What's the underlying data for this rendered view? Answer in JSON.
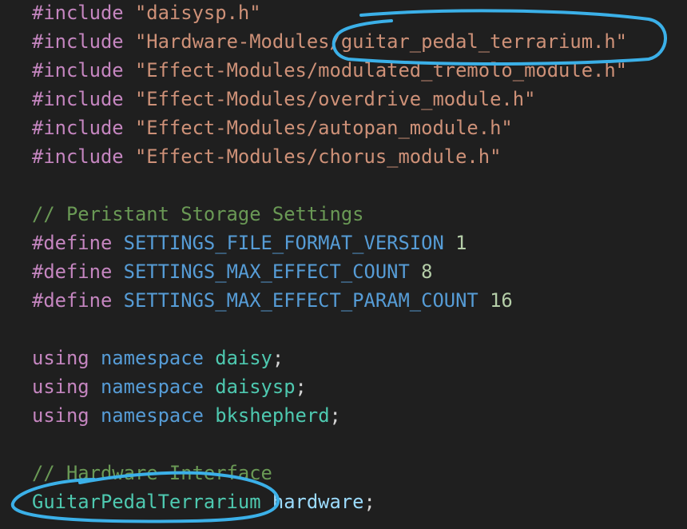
{
  "colors": {
    "background": "#1f1f1f",
    "preprocessor": "#c586c0",
    "string": "#ce9178",
    "macro": "#569cd6",
    "number": "#b5cea8",
    "comment": "#6a9955",
    "keyword": "#c586c0",
    "namespace_kw": "#569cd6",
    "namespace_name": "#4ec9b0",
    "type": "#4ec9b0",
    "identifier": "#9cdcfe",
    "punctuation": "#d4d4d4",
    "annotation": "#3bb0e8"
  },
  "annotations": [
    {
      "shape": "ellipse",
      "encircles": "guitar_pedal_terrarium.h"
    },
    {
      "shape": "ellipse",
      "encircles": "GuitarPedalTerrarium"
    }
  ],
  "lines": [
    {
      "tokens": [
        {
          "t": "#include",
          "c": "preprocessor"
        },
        {
          "t": " ",
          "c": "punctuation"
        },
        {
          "t": "\"daisysp.h\"",
          "c": "string"
        }
      ]
    },
    {
      "tokens": [
        {
          "t": "#include",
          "c": "preprocessor"
        },
        {
          "t": " ",
          "c": "punctuation"
        },
        {
          "t": "\"Hardware-Modules/guitar_pedal_terrarium.h\"",
          "c": "string"
        }
      ]
    },
    {
      "tokens": [
        {
          "t": "#include",
          "c": "preprocessor"
        },
        {
          "t": " ",
          "c": "punctuation"
        },
        {
          "t": "\"Effect-Modules/modulated_tremolo_module.h\"",
          "c": "string"
        }
      ]
    },
    {
      "tokens": [
        {
          "t": "#include",
          "c": "preprocessor"
        },
        {
          "t": " ",
          "c": "punctuation"
        },
        {
          "t": "\"Effect-Modules/overdrive_module.h\"",
          "c": "string"
        }
      ]
    },
    {
      "tokens": [
        {
          "t": "#include",
          "c": "preprocessor"
        },
        {
          "t": " ",
          "c": "punctuation"
        },
        {
          "t": "\"Effect-Modules/autopan_module.h\"",
          "c": "string"
        }
      ]
    },
    {
      "tokens": [
        {
          "t": "#include",
          "c": "preprocessor"
        },
        {
          "t": " ",
          "c": "punctuation"
        },
        {
          "t": "\"Effect-Modules/chorus_module.h\"",
          "c": "string"
        }
      ]
    },
    {
      "tokens": []
    },
    {
      "tokens": [
        {
          "t": "// Peristant Storage Settings",
          "c": "comment"
        }
      ]
    },
    {
      "tokens": [
        {
          "t": "#define",
          "c": "preprocessor"
        },
        {
          "t": " ",
          "c": "punctuation"
        },
        {
          "t": "SETTINGS_FILE_FORMAT_VERSION",
          "c": "macro"
        },
        {
          "t": " ",
          "c": "punctuation"
        },
        {
          "t": "1",
          "c": "number"
        }
      ]
    },
    {
      "tokens": [
        {
          "t": "#define",
          "c": "preprocessor"
        },
        {
          "t": " ",
          "c": "punctuation"
        },
        {
          "t": "SETTINGS_MAX_EFFECT_COUNT",
          "c": "macro"
        },
        {
          "t": " ",
          "c": "punctuation"
        },
        {
          "t": "8",
          "c": "number"
        }
      ]
    },
    {
      "tokens": [
        {
          "t": "#define",
          "c": "preprocessor"
        },
        {
          "t": " ",
          "c": "punctuation"
        },
        {
          "t": "SETTINGS_MAX_EFFECT_PARAM_COUNT",
          "c": "macro"
        },
        {
          "t": " ",
          "c": "punctuation"
        },
        {
          "t": "16",
          "c": "number"
        }
      ]
    },
    {
      "tokens": []
    },
    {
      "tokens": [
        {
          "t": "using",
          "c": "keyword"
        },
        {
          "t": " ",
          "c": "punctuation"
        },
        {
          "t": "namespace",
          "c": "namespace_kw"
        },
        {
          "t": " ",
          "c": "punctuation"
        },
        {
          "t": "daisy",
          "c": "namespace_name"
        },
        {
          "t": ";",
          "c": "punctuation"
        }
      ]
    },
    {
      "tokens": [
        {
          "t": "using",
          "c": "keyword"
        },
        {
          "t": " ",
          "c": "punctuation"
        },
        {
          "t": "namespace",
          "c": "namespace_kw"
        },
        {
          "t": " ",
          "c": "punctuation"
        },
        {
          "t": "daisysp",
          "c": "namespace_name"
        },
        {
          "t": ";",
          "c": "punctuation"
        }
      ]
    },
    {
      "tokens": [
        {
          "t": "using",
          "c": "keyword"
        },
        {
          "t": " ",
          "c": "punctuation"
        },
        {
          "t": "namespace",
          "c": "namespace_kw"
        },
        {
          "t": " ",
          "c": "punctuation"
        },
        {
          "t": "bkshepherd",
          "c": "namespace_name"
        },
        {
          "t": ";",
          "c": "punctuation"
        }
      ]
    },
    {
      "tokens": []
    },
    {
      "tokens": [
        {
          "t": "// Hardware Interface",
          "c": "comment"
        }
      ]
    },
    {
      "tokens": [
        {
          "t": "GuitarPedalTerrarium",
          "c": "type"
        },
        {
          "t": " ",
          "c": "punctuation"
        },
        {
          "t": "hardware",
          "c": "identifier"
        },
        {
          "t": ";",
          "c": "punctuation"
        }
      ]
    }
  ]
}
